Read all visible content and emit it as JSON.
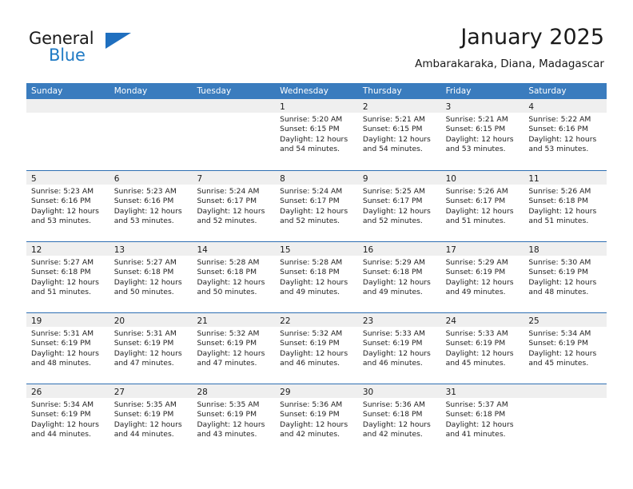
{
  "brand": {
    "name_part1": "General",
    "name_part2": "Blue",
    "logo_icon": "triangle-logo-icon"
  },
  "header": {
    "title": "January 2025",
    "subtitle": "Ambarakaraka, Diana, Madagascar"
  },
  "colors": {
    "header_blue": "#3a7cbe",
    "separator_blue": "#2f6fb3",
    "daynum_band": "#efefef",
    "brand_blue": "#1f7ac4",
    "text": "#1a1a1a"
  },
  "weekday_headers": [
    "Sunday",
    "Monday",
    "Tuesday",
    "Wednesday",
    "Thursday",
    "Friday",
    "Saturday"
  ],
  "weeks": [
    [
      {
        "day": "",
        "sunrise": "",
        "sunset": "",
        "daylight_line1": "",
        "daylight_line2": ""
      },
      {
        "day": "",
        "sunrise": "",
        "sunset": "",
        "daylight_line1": "",
        "daylight_line2": ""
      },
      {
        "day": "",
        "sunrise": "",
        "sunset": "",
        "daylight_line1": "",
        "daylight_line2": ""
      },
      {
        "day": "1",
        "sunrise": "Sunrise: 5:20 AM",
        "sunset": "Sunset: 6:15 PM",
        "daylight_line1": "Daylight: 12 hours",
        "daylight_line2": "and 54 minutes."
      },
      {
        "day": "2",
        "sunrise": "Sunrise: 5:21 AM",
        "sunset": "Sunset: 6:15 PM",
        "daylight_line1": "Daylight: 12 hours",
        "daylight_line2": "and 54 minutes."
      },
      {
        "day": "3",
        "sunrise": "Sunrise: 5:21 AM",
        "sunset": "Sunset: 6:15 PM",
        "daylight_line1": "Daylight: 12 hours",
        "daylight_line2": "and 53 minutes."
      },
      {
        "day": "4",
        "sunrise": "Sunrise: 5:22 AM",
        "sunset": "Sunset: 6:16 PM",
        "daylight_line1": "Daylight: 12 hours",
        "daylight_line2": "and 53 minutes."
      }
    ],
    [
      {
        "day": "5",
        "sunrise": "Sunrise: 5:23 AM",
        "sunset": "Sunset: 6:16 PM",
        "daylight_line1": "Daylight: 12 hours",
        "daylight_line2": "and 53 minutes."
      },
      {
        "day": "6",
        "sunrise": "Sunrise: 5:23 AM",
        "sunset": "Sunset: 6:16 PM",
        "daylight_line1": "Daylight: 12 hours",
        "daylight_line2": "and 53 minutes."
      },
      {
        "day": "7",
        "sunrise": "Sunrise: 5:24 AM",
        "sunset": "Sunset: 6:17 PM",
        "daylight_line1": "Daylight: 12 hours",
        "daylight_line2": "and 52 minutes."
      },
      {
        "day": "8",
        "sunrise": "Sunrise: 5:24 AM",
        "sunset": "Sunset: 6:17 PM",
        "daylight_line1": "Daylight: 12 hours",
        "daylight_line2": "and 52 minutes."
      },
      {
        "day": "9",
        "sunrise": "Sunrise: 5:25 AM",
        "sunset": "Sunset: 6:17 PM",
        "daylight_line1": "Daylight: 12 hours",
        "daylight_line2": "and 52 minutes."
      },
      {
        "day": "10",
        "sunrise": "Sunrise: 5:26 AM",
        "sunset": "Sunset: 6:17 PM",
        "daylight_line1": "Daylight: 12 hours",
        "daylight_line2": "and 51 minutes."
      },
      {
        "day": "11",
        "sunrise": "Sunrise: 5:26 AM",
        "sunset": "Sunset: 6:18 PM",
        "daylight_line1": "Daylight: 12 hours",
        "daylight_line2": "and 51 minutes."
      }
    ],
    [
      {
        "day": "12",
        "sunrise": "Sunrise: 5:27 AM",
        "sunset": "Sunset: 6:18 PM",
        "daylight_line1": "Daylight: 12 hours",
        "daylight_line2": "and 51 minutes."
      },
      {
        "day": "13",
        "sunrise": "Sunrise: 5:27 AM",
        "sunset": "Sunset: 6:18 PM",
        "daylight_line1": "Daylight: 12 hours",
        "daylight_line2": "and 50 minutes."
      },
      {
        "day": "14",
        "sunrise": "Sunrise: 5:28 AM",
        "sunset": "Sunset: 6:18 PM",
        "daylight_line1": "Daylight: 12 hours",
        "daylight_line2": "and 50 minutes."
      },
      {
        "day": "15",
        "sunrise": "Sunrise: 5:28 AM",
        "sunset": "Sunset: 6:18 PM",
        "daylight_line1": "Daylight: 12 hours",
        "daylight_line2": "and 49 minutes."
      },
      {
        "day": "16",
        "sunrise": "Sunrise: 5:29 AM",
        "sunset": "Sunset: 6:18 PM",
        "daylight_line1": "Daylight: 12 hours",
        "daylight_line2": "and 49 minutes."
      },
      {
        "day": "17",
        "sunrise": "Sunrise: 5:29 AM",
        "sunset": "Sunset: 6:19 PM",
        "daylight_line1": "Daylight: 12 hours",
        "daylight_line2": "and 49 minutes."
      },
      {
        "day": "18",
        "sunrise": "Sunrise: 5:30 AM",
        "sunset": "Sunset: 6:19 PM",
        "daylight_line1": "Daylight: 12 hours",
        "daylight_line2": "and 48 minutes."
      }
    ],
    [
      {
        "day": "19",
        "sunrise": "Sunrise: 5:31 AM",
        "sunset": "Sunset: 6:19 PM",
        "daylight_line1": "Daylight: 12 hours",
        "daylight_line2": "and 48 minutes."
      },
      {
        "day": "20",
        "sunrise": "Sunrise: 5:31 AM",
        "sunset": "Sunset: 6:19 PM",
        "daylight_line1": "Daylight: 12 hours",
        "daylight_line2": "and 47 minutes."
      },
      {
        "day": "21",
        "sunrise": "Sunrise: 5:32 AM",
        "sunset": "Sunset: 6:19 PM",
        "daylight_line1": "Daylight: 12 hours",
        "daylight_line2": "and 47 minutes."
      },
      {
        "day": "22",
        "sunrise": "Sunrise: 5:32 AM",
        "sunset": "Sunset: 6:19 PM",
        "daylight_line1": "Daylight: 12 hours",
        "daylight_line2": "and 46 minutes."
      },
      {
        "day": "23",
        "sunrise": "Sunrise: 5:33 AM",
        "sunset": "Sunset: 6:19 PM",
        "daylight_line1": "Daylight: 12 hours",
        "daylight_line2": "and 46 minutes."
      },
      {
        "day": "24",
        "sunrise": "Sunrise: 5:33 AM",
        "sunset": "Sunset: 6:19 PM",
        "daylight_line1": "Daylight: 12 hours",
        "daylight_line2": "and 45 minutes."
      },
      {
        "day": "25",
        "sunrise": "Sunrise: 5:34 AM",
        "sunset": "Sunset: 6:19 PM",
        "daylight_line1": "Daylight: 12 hours",
        "daylight_line2": "and 45 minutes."
      }
    ],
    [
      {
        "day": "26",
        "sunrise": "Sunrise: 5:34 AM",
        "sunset": "Sunset: 6:19 PM",
        "daylight_line1": "Daylight: 12 hours",
        "daylight_line2": "and 44 minutes."
      },
      {
        "day": "27",
        "sunrise": "Sunrise: 5:35 AM",
        "sunset": "Sunset: 6:19 PM",
        "daylight_line1": "Daylight: 12 hours",
        "daylight_line2": "and 44 minutes."
      },
      {
        "day": "28",
        "sunrise": "Sunrise: 5:35 AM",
        "sunset": "Sunset: 6:19 PM",
        "daylight_line1": "Daylight: 12 hours",
        "daylight_line2": "and 43 minutes."
      },
      {
        "day": "29",
        "sunrise": "Sunrise: 5:36 AM",
        "sunset": "Sunset: 6:19 PM",
        "daylight_line1": "Daylight: 12 hours",
        "daylight_line2": "and 42 minutes."
      },
      {
        "day": "30",
        "sunrise": "Sunrise: 5:36 AM",
        "sunset": "Sunset: 6:18 PM",
        "daylight_line1": "Daylight: 12 hours",
        "daylight_line2": "and 42 minutes."
      },
      {
        "day": "31",
        "sunrise": "Sunrise: 5:37 AM",
        "sunset": "Sunset: 6:18 PM",
        "daylight_line1": "Daylight: 12 hours",
        "daylight_line2": "and 41 minutes."
      },
      {
        "day": "",
        "sunrise": "",
        "sunset": "",
        "daylight_line1": "",
        "daylight_line2": ""
      }
    ]
  ]
}
